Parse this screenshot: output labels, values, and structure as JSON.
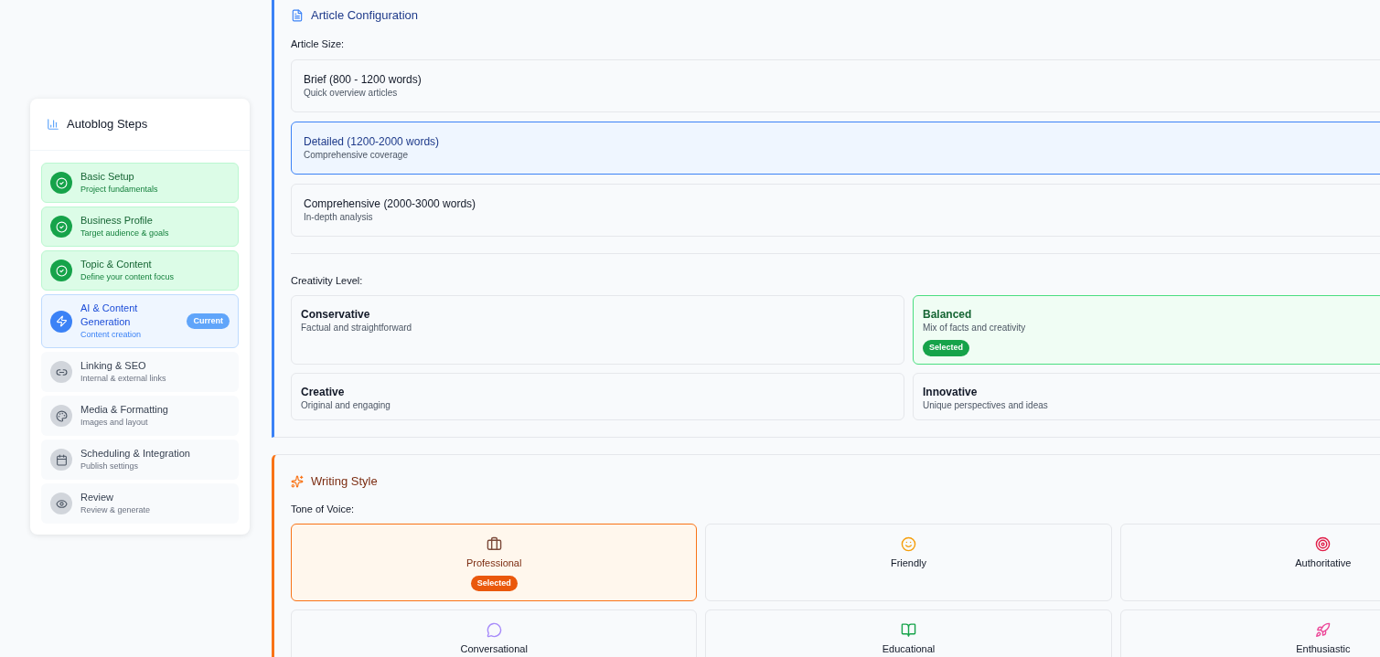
{
  "sidebar": {
    "title": "Autoblog Steps",
    "steps": [
      {
        "title": "Basic Setup",
        "subtitle": "Project fundamentals",
        "completed": true,
        "selected": false
      },
      {
        "title": "Business Profile",
        "subtitle": "Target audience & goals",
        "completed": true,
        "selected": false
      },
      {
        "title": "Topic & Content",
        "subtitle": "Define your content focus",
        "completed": true,
        "selected": false
      },
      {
        "title": "AI & Content Generation",
        "subtitle": "Content creation",
        "completed": false,
        "selected": true,
        "badge": "Current"
      },
      {
        "title": "Linking & SEO",
        "subtitle": "Internal & external links",
        "completed": false,
        "selected": false
      },
      {
        "title": "Media & Formatting",
        "subtitle": "Images and layout",
        "completed": false,
        "selected": false
      },
      {
        "title": "Scheduling & Integration",
        "subtitle": "Publish settings",
        "completed": false,
        "selected": false
      },
      {
        "title": "Review",
        "subtitle": "Review & generate",
        "completed": false,
        "selected": false
      }
    ]
  },
  "article_configuration": {
    "title": "Article Configuration",
    "size_label": "Article Size:",
    "sizes": [
      {
        "title": "Brief (800 - 1200 words)",
        "subtitle": "Quick overview articles",
        "selected": false
      },
      {
        "title": "Detailed (1200-2000 words)",
        "subtitle": "Comprehensive coverage",
        "selected": true
      },
      {
        "title": "Comprehensive (2000-3000 words)",
        "subtitle": "In-depth analysis",
        "selected": false
      }
    ],
    "creativity_label": "Creativity Level:",
    "creativity": [
      {
        "title": "Conservative",
        "subtitle": "Factual and straightforward",
        "selected": false
      },
      {
        "title": "Balanced",
        "subtitle": "Mix of facts and creativity",
        "selected": true,
        "badge": "Selected"
      },
      {
        "title": "Creative",
        "subtitle": "Original and engaging",
        "selected": false
      },
      {
        "title": "Innovative",
        "subtitle": "Unique perspectives and ideas",
        "selected": false
      }
    ]
  },
  "writing_style": {
    "title": "Writing Style",
    "tone_label": "Tone of Voice:",
    "tones": [
      {
        "label": "Professional",
        "selected": true,
        "badge": "Selected"
      },
      {
        "label": "Friendly",
        "selected": false
      },
      {
        "label": "Authoritative",
        "selected": false
      },
      {
        "label": "Conversational",
        "selected": false
      },
      {
        "label": "Educational",
        "selected": false
      },
      {
        "label": "Enthusiastic",
        "selected": false
      }
    ]
  }
}
